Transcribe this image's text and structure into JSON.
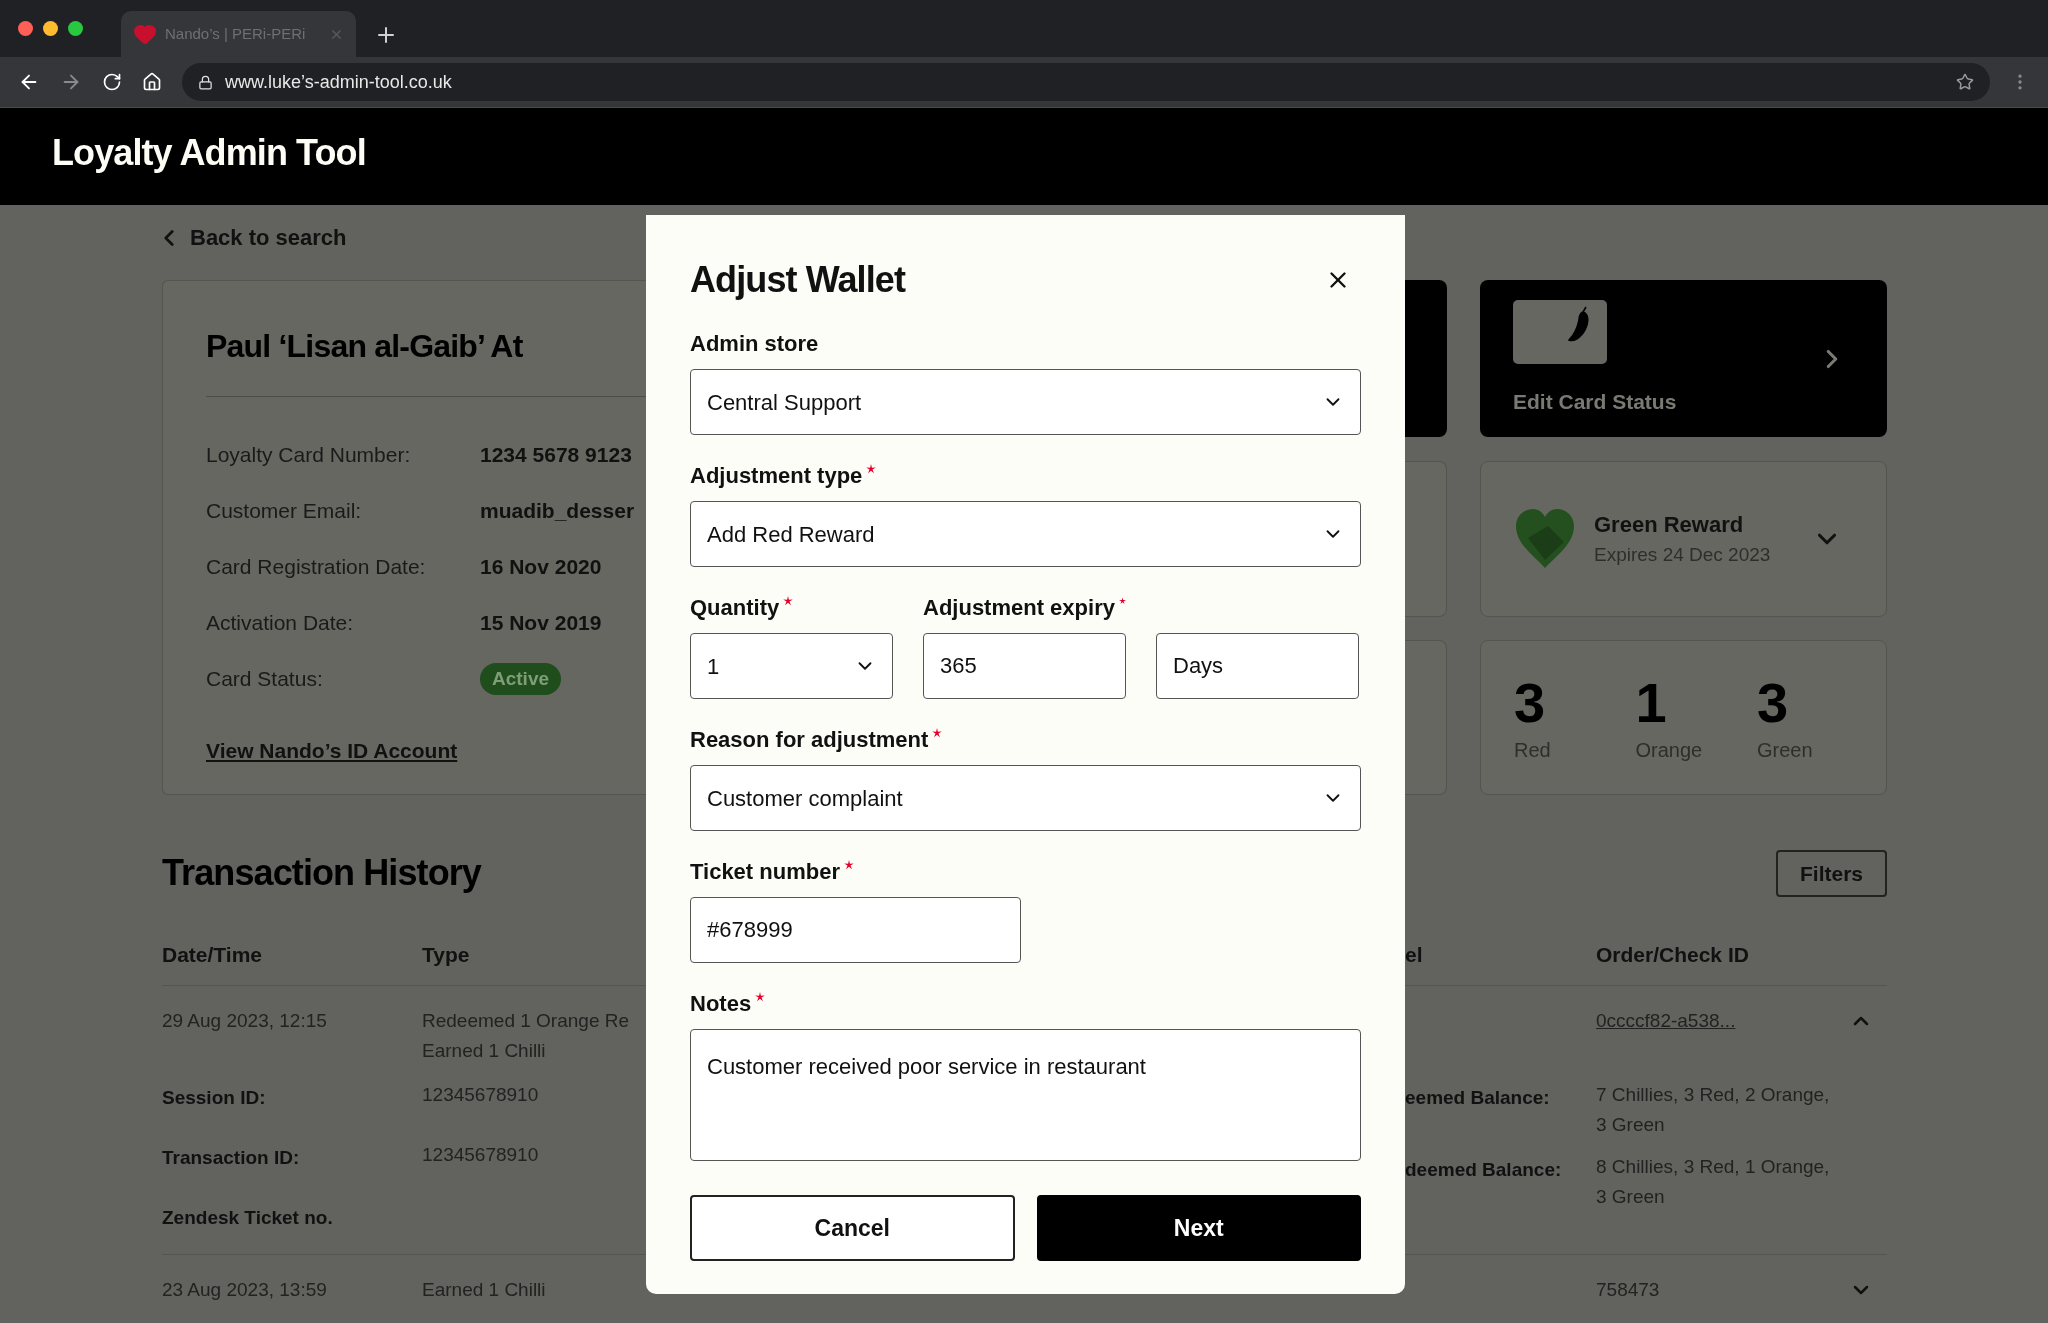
{
  "browser": {
    "tab_title": "Nando’s | PERi-PERi",
    "url": "www.luke’s-admin-tool.co.uk"
  },
  "header": {
    "title": "Loyalty Admin Tool"
  },
  "back_link": "Back to search",
  "customer": {
    "name": "Paul ‘Lisan al-Gaib’ At",
    "fields": [
      {
        "label": "Loyalty Card Number:",
        "value": "1234 5678 9123",
        "kind": "text"
      },
      {
        "label": "Customer Email:",
        "value": "muadib_desser",
        "kind": "text"
      },
      {
        "label": "Card Registration Date:",
        "value": "16 Nov 2020",
        "kind": "text"
      },
      {
        "label": "Activation Date:",
        "value": "15 Nov 2019",
        "kind": "text"
      },
      {
        "label": "Card Status:",
        "value": "Active",
        "kind": "badge"
      }
    ],
    "link": "View Nando’s ID Account"
  },
  "action_card": {
    "label": "Edit Card Status"
  },
  "reward": {
    "title": "Green Reward",
    "expiry": "Expires 24 Dec 2023"
  },
  "balances": [
    {
      "count": "3",
      "label": "Red"
    },
    {
      "count": "1",
      "label": "Orange"
    },
    {
      "count": "3",
      "label": "Green"
    }
  ],
  "transactions": {
    "title": "Transaction History",
    "filters_button": "Filters",
    "columns": [
      "Date/Time",
      "Type",
      "el",
      "Order/Check ID"
    ],
    "rows": [
      {
        "date": "29 Aug 2023, 12:15",
        "type_lines": [
          "Redeemed 1 Orange Re",
          "Earned 1 Chilli"
        ],
        "order_id": "0ccccf82-a538...",
        "linked": true,
        "expanded": true,
        "details": [
          {
            "label": "Session ID:",
            "value": "12345678910"
          },
          {
            "label": "Transaction ID:",
            "value": "12345678910"
          },
          {
            "label": "Zendesk Ticket no."
          }
        ],
        "right_details": [
          {
            "label": "eemed Balance:",
            "value": "7 Chillies, 3 Red, 2 Orange, 3 Green"
          },
          {
            "label": "deemed Balance:",
            "value": "8 Chillies, 3 Red, 1 Orange, 3 Green"
          }
        ]
      },
      {
        "date": "23 Aug 2023, 13:59",
        "type_lines": [
          "Earned 1 Chilli"
        ],
        "order_id": "758473",
        "linked": false,
        "expanded": false
      }
    ]
  },
  "modal": {
    "title": "Adjust Wallet",
    "fields": [
      {
        "kind": "select",
        "label": "Admin store",
        "required": false,
        "value": "Central Support"
      },
      {
        "kind": "select",
        "label": "Adjustment type",
        "required": true,
        "value": "Add Red Reward"
      },
      {
        "kind": "group",
        "items": [
          {
            "kind": "small_select",
            "label": "Quantity",
            "required": true,
            "value": "1"
          },
          {
            "kind": "small_input",
            "label": "Adjustment expiry",
            "required": true,
            "value": "365"
          },
          {
            "kind": "small_input",
            "value": "Days"
          }
        ]
      },
      {
        "kind": "select",
        "label": "Reason for adjustment",
        "required": true,
        "value": "Customer complaint"
      },
      {
        "kind": "short_input",
        "label": "Ticket number",
        "required": true,
        "value": "#678999"
      },
      {
        "kind": "textarea",
        "label": "Notes",
        "required": true,
        "value": "Customer received poor service in restaurant"
      }
    ],
    "buttons": [
      {
        "label": "Cancel",
        "kind": "secondary"
      },
      {
        "label": "Next",
        "kind": "primary"
      }
    ]
  }
}
